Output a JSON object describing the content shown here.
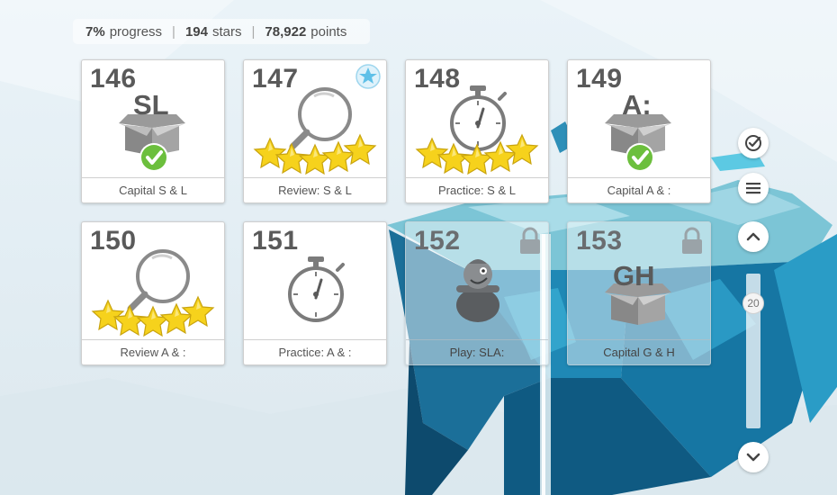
{
  "stats": {
    "progress_value": "7%",
    "progress_label": "progress",
    "stars_value": "194",
    "stars_label": "stars",
    "points_value": "78,922",
    "points_label": "points"
  },
  "lessons": [
    {
      "number": "146",
      "caption": "Capital S & L",
      "icon": "box-icon",
      "box_text": "SL",
      "completed": true,
      "locked": false
    },
    {
      "number": "147",
      "caption": "Review: S & L",
      "icon": "magnifier-icon",
      "stars": 5,
      "badge": "star-badge-icon",
      "locked": false
    },
    {
      "number": "148",
      "caption": "Practice: S & L",
      "icon": "stopwatch-icon",
      "stars": 5,
      "locked": false
    },
    {
      "number": "149",
      "caption": "Capital A & :",
      "icon": "box-icon",
      "box_text": "A:",
      "completed": true,
      "locked": false
    },
    {
      "number": "150",
      "caption": "Review A & :",
      "icon": "magnifier-icon",
      "stars": 5,
      "locked": false
    },
    {
      "number": "151",
      "caption": "Practice: A & :",
      "icon": "stopwatch-icon",
      "stars": 0,
      "locked": false
    },
    {
      "number": "152",
      "caption": "Play: SLA:",
      "icon": "game-character-icon",
      "locked": true
    },
    {
      "number": "153",
      "caption": "Capital G & H",
      "icon": "box-icon",
      "box_text": "GH",
      "locked": true
    }
  ],
  "scroll": {
    "position": "20"
  },
  "colors": {
    "card_bg": "#ffffff",
    "text": "#5a5a5a",
    "check_green": "#6cbf3d",
    "star_yellow": "#f6d21c",
    "badge_blue": "#5fc0e8"
  }
}
